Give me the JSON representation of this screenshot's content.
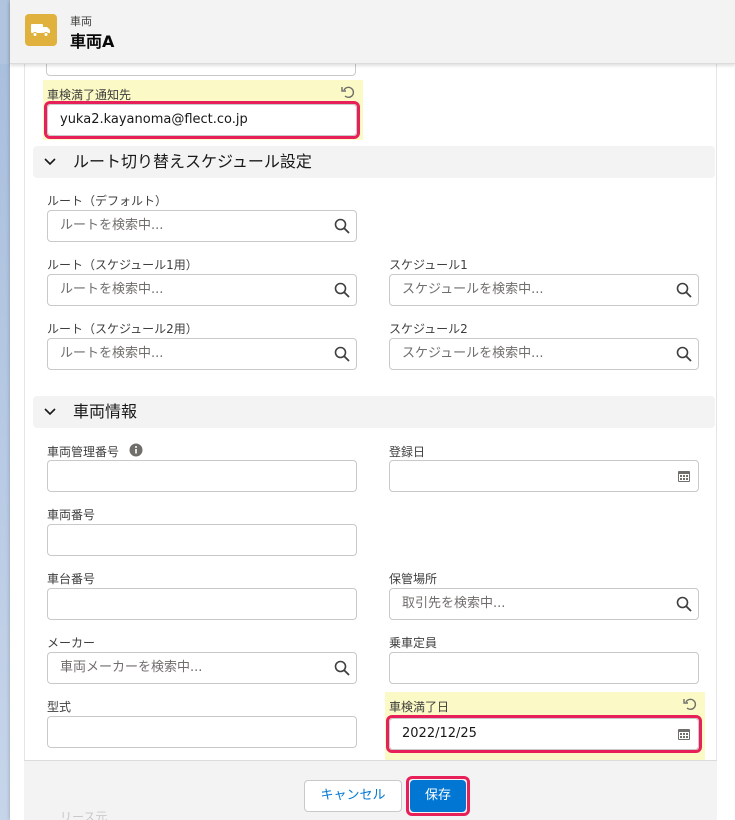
{
  "header": {
    "object_label": "車両",
    "record_title": "車両A",
    "icon": "truck-icon"
  },
  "fields": {
    "inspection_notify": {
      "label": "車検満了通知先",
      "value": "yuka2.kayanoma@flect.co.jp"
    },
    "route_default": {
      "label": "ルート（デフォルト）",
      "placeholder": "ルートを検索中..."
    },
    "route_schedule1": {
      "label": "ルート（スケジュール1用）",
      "placeholder": "ルートを検索中..."
    },
    "schedule1": {
      "label": "スケジュール1",
      "placeholder": "スケジュールを検索中..."
    },
    "route_schedule2": {
      "label": "ルート（スケジュール2用）",
      "placeholder": "ルートを検索中..."
    },
    "schedule2": {
      "label": "スケジュール2",
      "placeholder": "スケジュールを検索中..."
    },
    "vehicle_mgmt_no": {
      "label": "車両管理番号",
      "value": ""
    },
    "registration_date": {
      "label": "登録日",
      "value": ""
    },
    "vehicle_no": {
      "label": "車両番号",
      "value": ""
    },
    "chassis_no": {
      "label": "車台番号",
      "value": ""
    },
    "storage_location": {
      "label": "保管場所",
      "placeholder": "取引先を検索中..."
    },
    "maker": {
      "label": "メーカー",
      "placeholder": "車両メーカーを検索中..."
    },
    "capacity": {
      "label": "乗車定員",
      "value": ""
    },
    "model": {
      "label": "型式",
      "value": ""
    },
    "inspection_expiry": {
      "label": "車検満了日",
      "value": "2022/12/25"
    }
  },
  "sections": {
    "route_schedule": "ルート切り替えスケジュール設定",
    "vehicle_info": "車両情報"
  },
  "footer": {
    "cancel_label": "キャンセル",
    "save_label": "保存",
    "ghost_text": "リース元"
  },
  "colors": {
    "highlight": "#fbf9c5",
    "red_outline": "#e8205a",
    "brand_blue": "#0176d3",
    "object_icon": "#e0b23d"
  }
}
